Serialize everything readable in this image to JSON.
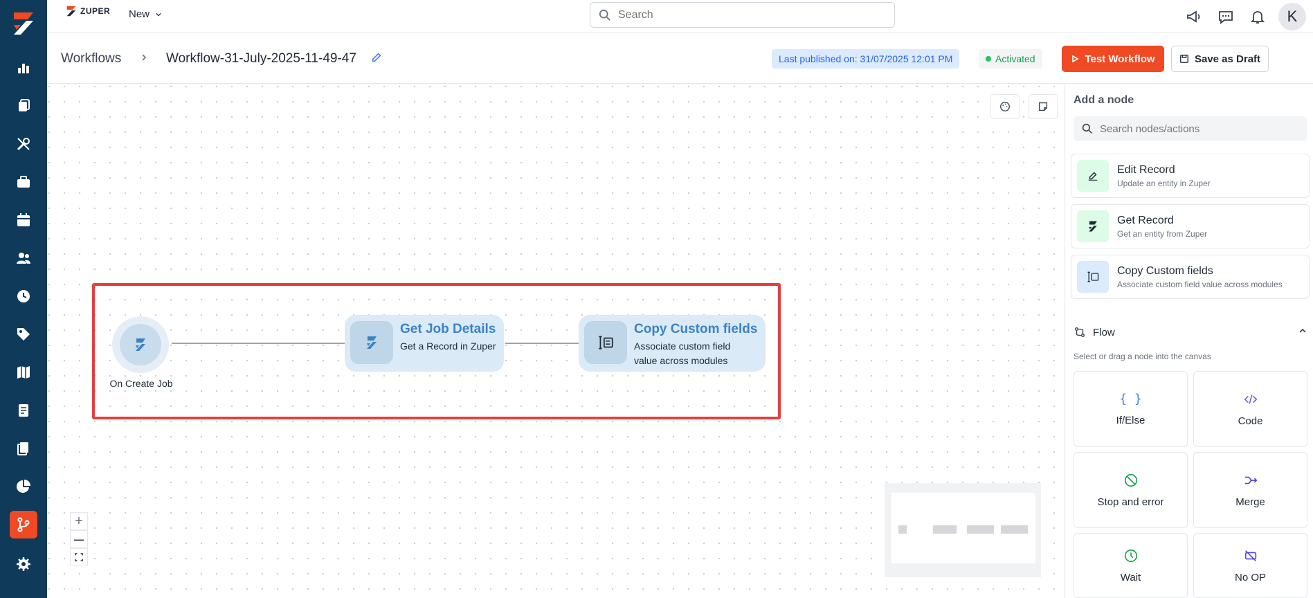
{
  "topbar": {
    "brand": "ZUPER",
    "new_label": "New",
    "search_placeholder": "Search",
    "avatar_initial": "K"
  },
  "header": {
    "breadcrumb_root": "Workflows",
    "workflow_title": "Workflow-31-July-2025-11-49-47",
    "published": "Last published on: 31/07/2025 12:01 PM",
    "status": "Activated",
    "test_button": "Test Workflow",
    "draft_button": "Save as Draft"
  },
  "canvas": {
    "trigger": {
      "label": "On Create Job"
    },
    "nodes": [
      {
        "title": "Get Job Details",
        "subtitle": "Get a Record in Zuper"
      },
      {
        "title": "Copy Custom fields",
        "subtitle_line1": "Associate custom field",
        "subtitle_line2": "value across modules"
      }
    ],
    "zoom_in": "+",
    "zoom_out": "—"
  },
  "panel": {
    "title": "Add a node",
    "search_placeholder": "Search nodes/actions",
    "cards": [
      {
        "title": "Edit Record",
        "subtitle": "Update an entity in Zuper",
        "icon": "edit-icon",
        "color": "#dcfce7"
      },
      {
        "title": "Get Record",
        "subtitle": "Get an entity from Zuper",
        "icon": "zuper-icon",
        "color": "#dcfce7"
      },
      {
        "title": "Copy Custom fields",
        "subtitle": "Associate custom field value across modules",
        "icon": "copy-fields-icon",
        "color": "#dbeafe"
      }
    ],
    "flow": {
      "label": "Flow",
      "hint": "Select or drag a node into the canvas",
      "tiles": [
        {
          "label": "If/Else",
          "icon": "braces-icon"
        },
        {
          "label": "Code",
          "icon": "code-icon"
        },
        {
          "label": "Stop and error",
          "icon": "stop-icon"
        },
        {
          "label": "Merge",
          "icon": "merge-icon"
        },
        {
          "label": "Wait",
          "icon": "clock-icon"
        },
        {
          "label": "No OP",
          "icon": "no-op-icon"
        }
      ]
    }
  },
  "colors": {
    "sidebar": "#0f3a5a",
    "accent": "#ef4a24",
    "highlight": "#e53e3e",
    "node_title": "#3b82c4",
    "flow_icon": "#16a34a"
  }
}
